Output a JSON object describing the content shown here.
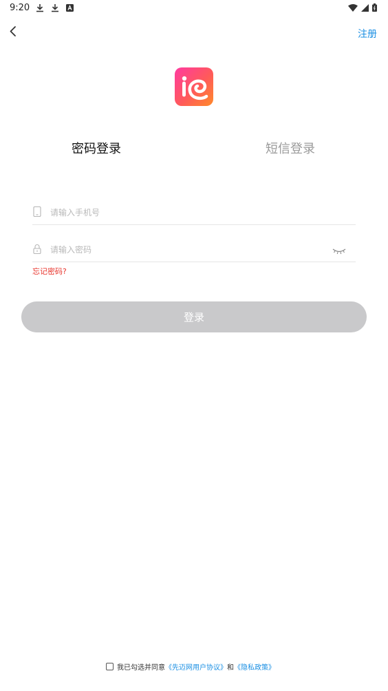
{
  "status_bar": {
    "time": "9:20",
    "icons": [
      "download-icon",
      "download-icon",
      "app-notification-icon",
      "wifi-icon",
      "signal-icon",
      "battery-icon"
    ]
  },
  "header": {
    "back_icon": "chevron-left-icon",
    "register_label": "注册"
  },
  "logo": {
    "colors": [
      "#ff3aa0",
      "#ff5a5a",
      "#ff8a2a"
    ]
  },
  "tabs": [
    {
      "label": "密码登录",
      "active": true
    },
    {
      "label": "短信登录",
      "active": false
    }
  ],
  "form": {
    "phone_placeholder": "请输入手机号",
    "phone_icon": "phone-icon",
    "password_placeholder": "请输入密码",
    "password_icon": "lock-icon",
    "eye_icon": "eye-closed-icon",
    "forgot_label": "忘记密码?",
    "login_label": "登录"
  },
  "agreement": {
    "prefix": "我已勾选并同意",
    "user_agreement": "《先迈网用户协议》",
    "and": "和",
    "privacy_policy": "《隐私政策》"
  },
  "colors": {
    "accent": "#1a8fe3",
    "warning": "#e8342c",
    "button_disabled": "#c9c9cb"
  }
}
